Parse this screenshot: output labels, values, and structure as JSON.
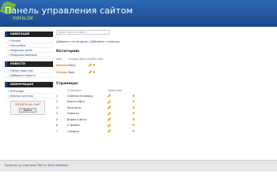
{
  "header": {
    "title": "Панель управления сайтом",
    "subtitle": "КИНЬЗИ"
  },
  "sidebar": {
    "sections": [
      {
        "heading": "НАВИГАЦИЯ",
        "items": [
          "Начало",
          "Настройки",
          "Редакция меню",
          "Редакция шаблона"
        ]
      },
      {
        "heading": "НОВОСТИ",
        "items": [
          "Обзор новостей",
          "Добавить новость"
        ]
      },
      {
        "heading": "ИНФОРМАЦИЯ",
        "info": [
          "PHP-инфо",
          "Версия системы"
        ]
      }
    ],
    "online_label": "ПЕРЕЙТИ НА САЙТ",
    "logout_label": "Выйти"
  },
  "main": {
    "note_placeholder": "Ваши заметки здесь",
    "links": [
      "Добавить категорию",
      "Добавить страницу"
    ],
    "categories_title": "Категории:",
    "cat_headers": [
      "Имя",
      "Ссылка Доступ",
      "Действия"
    ],
    "categories": [
      {
        "name": "Начало",
        "link": "Index"
      },
      {
        "name": "Статьи",
        "link": "Main"
      }
    ],
    "pages_title": "Страницы:",
    "page_headers": [
      "",
      "Страница",
      "Действия"
    ],
    "pages": [
      {
        "num": "1",
        "title": "Главная страница"
      },
      {
        "num": "2",
        "title": "Карта сайта"
      },
      {
        "num": "3",
        "title": "Контакты"
      },
      {
        "num": "4",
        "title": "Новости"
      },
      {
        "num": "5",
        "title": "Видео и фото"
      },
      {
        "num": "6",
        "title": "О фирме"
      },
      {
        "num": "7",
        "title": "Галерея"
      }
    ]
  },
  "footer": {
    "prefix": "Powered by:",
    "link": "Система CMS от Kinzi Software"
  },
  "colors": {
    "header": "#1b4a8c",
    "accent_orange": "#e07a10",
    "sidebar_head": "#222222"
  }
}
